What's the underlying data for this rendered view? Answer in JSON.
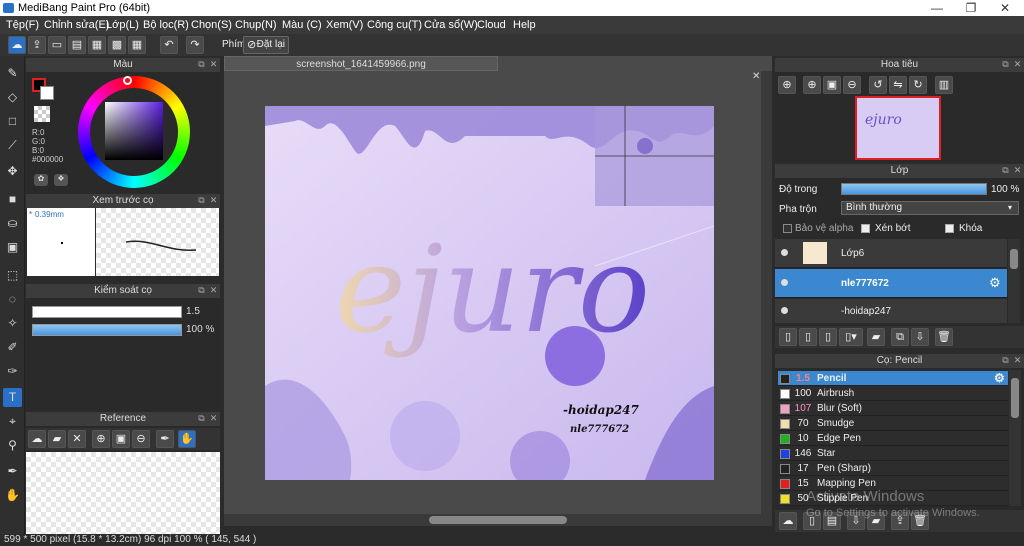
{
  "title_bar": {
    "title": "MediBang Paint Pro (64bit)",
    "minimize": "—",
    "restore": "❐",
    "close": "✕"
  },
  "menu": [
    "Tệp(F)",
    "Chỉnh sửa(E)",
    "Lớp(L)",
    "Bộ lọc(R)",
    "Chọn(S)",
    "Chụp(N)",
    "Màu (C)",
    "Xem(V)",
    "Công cụ(T)",
    "Cửa sổ(W)",
    "Cloud",
    "Help"
  ],
  "toolbar": {
    "phim_label": "Phím",
    "reset_label": "Đặt lại"
  },
  "panels": {
    "color": {
      "title": "Màu",
      "r": "R:0",
      "g": "G:0",
      "b": "B:0",
      "hex": "#000000"
    },
    "preview": {
      "title": "Xem trước cọ",
      "size": "0.39mm"
    },
    "brush_control": {
      "title": "Kiểm soát cọ",
      "size_value": "1.5",
      "opacity_value": "100 %",
      "opacity_fraction": 1.0
    },
    "reference": {
      "title": "Reference"
    },
    "navigator": {
      "title": "Hoa tiêu"
    },
    "layer": {
      "title": "Lớp",
      "opacity_label": "Độ trong",
      "opacity_value": "100 %",
      "opacity_fraction": 1.0,
      "blend_label": "Pha trộn",
      "blend_value": "Bình thường",
      "protect_alpha": "Bảo vệ alpha",
      "clipping": "Xén bớt",
      "lock": "Khóa",
      "layers": [
        {
          "name": "Lớp6",
          "selected": false
        },
        {
          "name": "nle777672",
          "selected": true
        },
        {
          "name": "-hoidap247",
          "selected": false
        }
      ]
    },
    "brush": {
      "title": "Cọ: Pencil",
      "items": [
        {
          "size": "1.5",
          "name": "Pencil",
          "color": "#222222",
          "selected": true
        },
        {
          "size": "100",
          "name": "Airbrush",
          "color": "#ffffff",
          "selected": false
        },
        {
          "size": "107",
          "name": "Blur (Soft)",
          "color": "#f0a0c0",
          "selected": false
        },
        {
          "size": "70",
          "name": "Smudge",
          "color": "#f0e0b0",
          "selected": false
        },
        {
          "size": "10",
          "name": "Edge Pen",
          "color": "#20b020",
          "selected": false
        },
        {
          "size": "146",
          "name": "Star",
          "color": "#2040e0",
          "selected": false
        },
        {
          "size": "17",
          "name": "Pen (Sharp)",
          "color": "#222222",
          "selected": false
        },
        {
          "size": "15",
          "name": "Mapping Pen",
          "color": "#e02020",
          "selected": false
        },
        {
          "size": "50",
          "name": "Stipple Pen",
          "color": "#f0e020",
          "selected": false
        }
      ]
    }
  },
  "document": {
    "tab": "screenshot_1641459966.png",
    "art_text_main": "ejuro",
    "art_text_1": "-hoidap247",
    "art_text_2": "nle777672"
  },
  "watermark": {
    "line1": "Activate Windows",
    "line2": "Go to Settings to activate Windows."
  },
  "status": {
    "text": "599 * 500 pixel   (15.8 * 13.2cm)   96 dpi   100 %   ( 145, 544 )"
  }
}
